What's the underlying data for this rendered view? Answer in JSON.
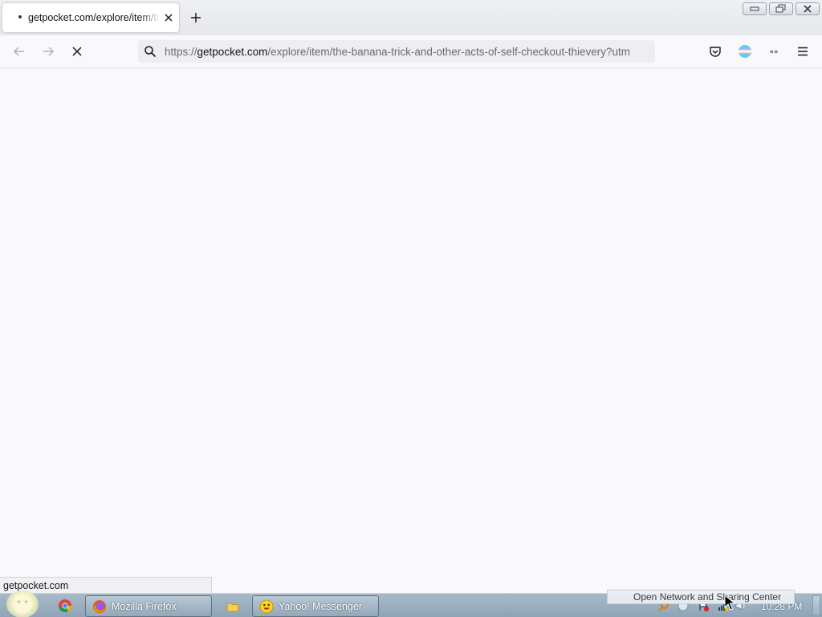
{
  "tab": {
    "title": "getpocket.com/explore/item/the-banana-trick-and-other-acts-of-self-checkout-thievery",
    "close_icon": "close-icon"
  },
  "new_tab_icon": "plus-icon",
  "window_controls": [
    "minimize-icon",
    "restore-icon",
    "close-icon"
  ],
  "navbar": {
    "back_icon": "arrow-left-icon",
    "forward_icon": "arrow-right-icon",
    "stop_icon": "stop-icon",
    "url": {
      "scheme": "https://",
      "domain": "getpocket.com",
      "path": "/explore/item/the-banana-trick-and-other-acts-of-self-checkout-thievery?utm"
    },
    "right_icons": [
      "pocket-icon",
      "account-icon",
      "extensions-icon",
      "hamburger-menu-icon"
    ]
  },
  "status": {
    "text": "getpocket.com"
  },
  "taskbar": {
    "tasks": [
      {
        "label": "Mozilla Firefox",
        "icon": "firefox-icon"
      },
      {
        "label": "",
        "icon": "folder-icon"
      },
      {
        "label": "Yahoo! Messenger",
        "icon": "yahoo-messenger-icon"
      }
    ],
    "tooltip": "Open Network and Sharing Center",
    "clock": "10:28 PM",
    "colors": {
      "taskbar": "#9aaebd",
      "accent": "#0060df"
    }
  }
}
